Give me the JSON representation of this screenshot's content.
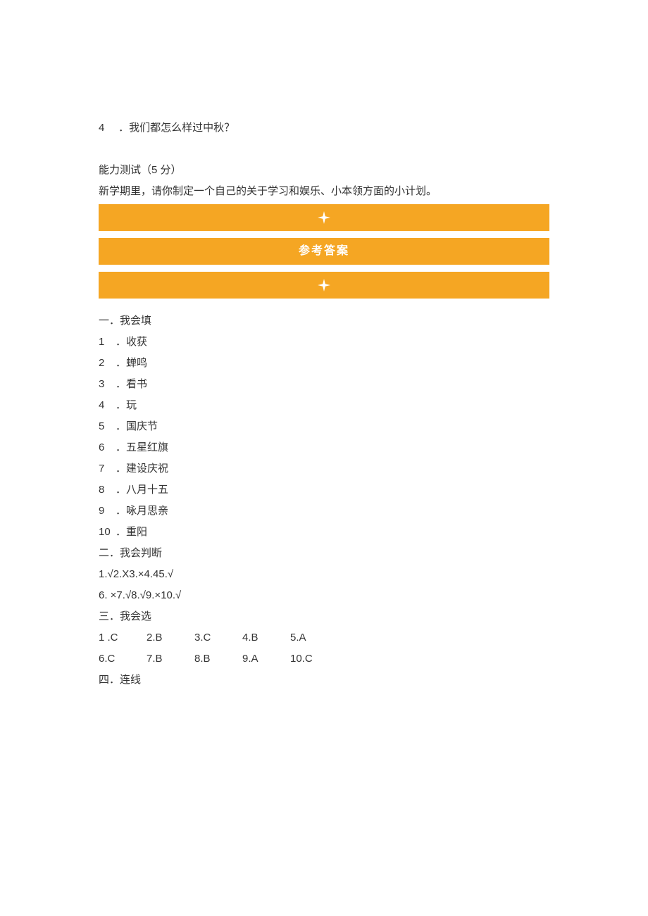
{
  "q4": {
    "num": "4",
    "text": "．我们都怎么样过中秋？"
  },
  "ability": {
    "title": "能力测试（5 分）",
    "prompt": "新学期里，请你制定一个自己的关于学习和娱乐、小本领方面的小计划。"
  },
  "banner_label": "参考答案",
  "answers": {
    "fill": {
      "heading": "一．我会填",
      "items": [
        {
          "n": "1",
          "t": "．收获"
        },
        {
          "n": "2",
          "t": "．蝉鸣"
        },
        {
          "n": "3",
          "t": "．看书"
        },
        {
          "n": "4",
          "t": "．玩"
        },
        {
          "n": "5",
          "t": "．国庆节"
        },
        {
          "n": "6",
          "t": "．五星红旗"
        },
        {
          "n": "7",
          "t": "．建设庆祝"
        },
        {
          "n": "8",
          "t": "．八月十五"
        },
        {
          "n": "9",
          "t": "．咏月思亲"
        },
        {
          "n": "10",
          "t": "．重阳"
        }
      ]
    },
    "judge": {
      "heading": "二．我会判断",
      "line1": "1.√2.X3.×4.45.√",
      "line2": "6.   ×7.√8.√9.×10.√"
    },
    "select": {
      "heading": "三．我会选",
      "row1": [
        "1 .C",
        "2.B",
        "3.C",
        "4.B",
        "5.A"
      ],
      "row2": [
        "6.C",
        "7.B",
        "8.B",
        "9.A",
        "10.C"
      ]
    },
    "match": {
      "heading": "四．连线"
    }
  }
}
